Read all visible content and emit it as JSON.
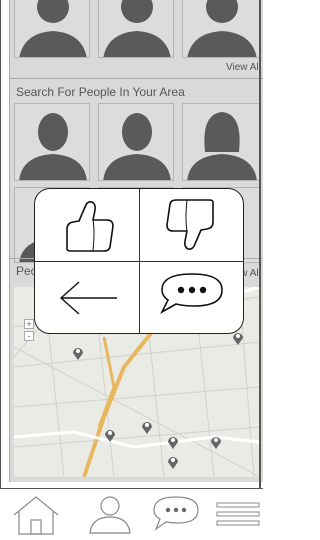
{
  "top_row": {
    "view_all": "View All"
  },
  "search_section": {
    "title": "Search For People In Your Area",
    "view_all": "View All"
  },
  "people_section": {
    "title_partial": "Peo"
  },
  "map": {
    "zoom_in": "+",
    "zoom_out": "-"
  },
  "overlay": {
    "thumbs_up": "thumbs-up-icon",
    "thumbs_down": "thumbs-down-icon",
    "back": "arrow-left-icon",
    "chat": "chat-bubble-icon"
  },
  "tabbar": [
    "home-icon",
    "profile-icon",
    "chat-icon",
    "menu-icon"
  ],
  "colors": {
    "screen_bg": "#d9d9d9",
    "map_road": "#e8b860",
    "pin": "#666666"
  }
}
